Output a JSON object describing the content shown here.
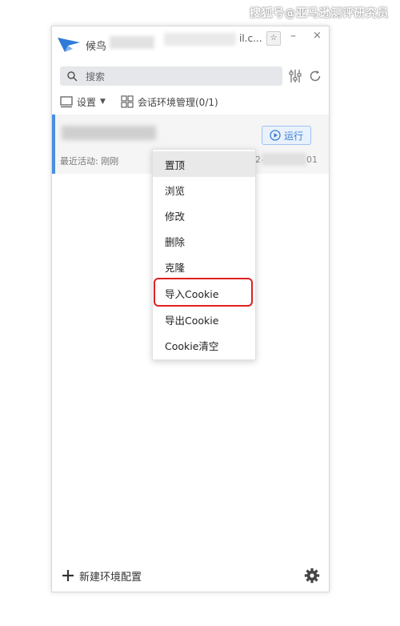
{
  "watermark": "搜狐号@亚马逊测评研究员",
  "window": {
    "app_title": "候鸟",
    "title_suffix": "il.c...",
    "pin_glyph": "☆",
    "min_glyph": "–",
    "close_glyph": "×"
  },
  "search": {
    "placeholder": "搜索",
    "value": ""
  },
  "toolbar": {
    "settings_label": "设置",
    "env_label": "会话环境管理(0/1)"
  },
  "profile": {
    "run_label": "运行",
    "last_active": "最近活动: 刚刚",
    "date_prefix": "2-",
    "date_suffix": "01"
  },
  "context_menu": {
    "items": [
      {
        "label": "置顶"
      },
      {
        "label": "浏览"
      },
      {
        "label": "修改"
      },
      {
        "label": "删除"
      },
      {
        "label": "克隆"
      },
      {
        "label": "导入Cookie"
      },
      {
        "label": "导出Cookie"
      },
      {
        "label": "Cookie清空"
      }
    ],
    "hovered_index": 0,
    "highlighted_index": 5
  },
  "footer": {
    "new_env_label": "新建环境配置"
  },
  "colors": {
    "accent": "#4a8fe0",
    "highlight": "#e02020",
    "run_button": "#3d7fd6"
  },
  "icons": [
    "logo-icon",
    "search-icon",
    "filter-icon",
    "refresh-icon",
    "settings-icon",
    "grid-icon",
    "play-icon",
    "plus-icon",
    "gear-icon"
  ]
}
